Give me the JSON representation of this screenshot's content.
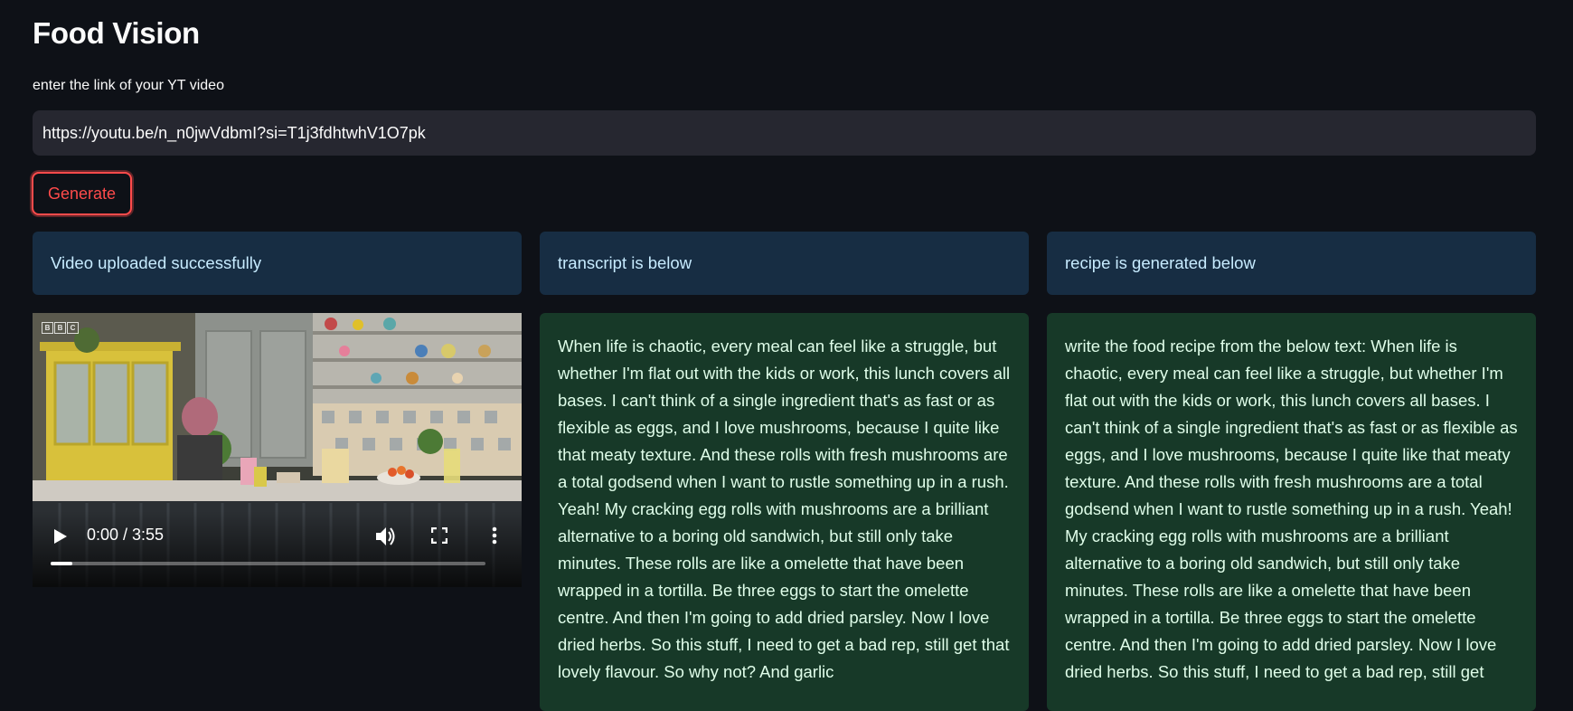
{
  "app": {
    "title": "Food Vision"
  },
  "form": {
    "label": "enter the link of your YT video",
    "url_value": "https://youtu.be/n_n0jwVdbmI?si=T1j3fdhtwhV1O7pk",
    "generate_label": "Generate"
  },
  "status": {
    "video": "Video uploaded successfully",
    "transcript": "transcript is below",
    "recipe": "recipe is generated below"
  },
  "video_player": {
    "logo": [
      "B",
      "B",
      "C"
    ],
    "time": "0:00 / 3:55",
    "progress": 0.0
  },
  "transcript_text": "When life is chaotic, every meal can feel like a struggle, but whether I'm flat out with the kids or work, this lunch covers all bases. I can't think of a single ingredient that's as fast or as flexible as eggs, and I love mushrooms, because I quite like that meaty texture. And these rolls with fresh mushrooms are a total godsend when I want to rustle something up in a rush. Yeah! My cracking egg rolls with mushrooms are a brilliant alternative to a boring old sandwich, but still only take minutes. These rolls are like a omelette that have been wrapped in a tortilla. Be three eggs to start the omelette centre. And then I'm going to add dried parsley. Now I love dried herbs. So this stuff, I need to get a bad rep, still get that lovely flavour. So why not? And garlic",
  "recipe_text": "write the food recipe from the below text: When life is chaotic, every meal can feel like a struggle, but whether I'm flat out with the kids or work, this lunch covers all bases. I can't think of a single ingredient that's as fast or as flexible as eggs, and I love mushrooms, because I quite like that meaty texture. And these rolls with fresh mushrooms are a total godsend when I want to rustle something up in a rush. Yeah! My cracking egg rolls with mushrooms are a brilliant alternative to a boring old sandwich, but still only take minutes. These rolls are like a omelette that have been wrapped in a tortilla. Be three eggs to start the omelette centre. And then I'm going to add dried parsley. Now I love dried herbs. So this stuff, I need to get a bad rep, still get",
  "colors": {
    "background": "#0e1117",
    "accent": "#ff4b4b",
    "info_bg": "#172d43",
    "info_text": "#c7ebff",
    "success_bg": "#173928",
    "success_text": "#dffde9",
    "input_bg": "#262730"
  },
  "icons": {
    "play": "play-icon",
    "volume": "volume-icon",
    "fullscreen": "fullscreen-icon",
    "more": "more-options-icon"
  }
}
